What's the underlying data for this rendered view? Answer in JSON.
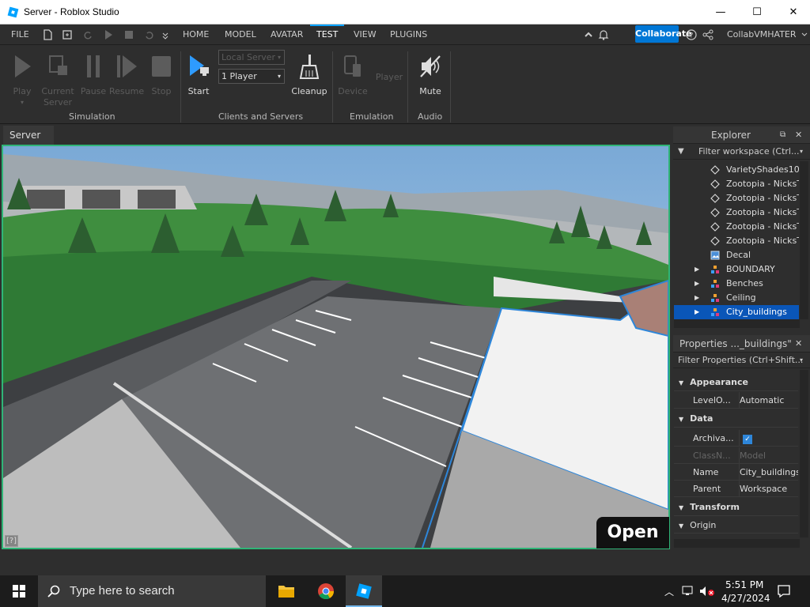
{
  "window": {
    "title": "Server - Roblox Studio",
    "minimize": "—",
    "maximize": "☐",
    "close": "✕"
  },
  "menubar": {
    "file": "FILE",
    "tabs": [
      {
        "label": "HOME"
      },
      {
        "label": "MODEL"
      },
      {
        "label": "AVATAR"
      },
      {
        "label": "TEST"
      },
      {
        "label": "VIEW"
      },
      {
        "label": "PLUGINS"
      }
    ],
    "active_tab": "TEST",
    "collaborate": "Collaborate",
    "username": "CollabVMHATER"
  },
  "ribbon": {
    "simulation": {
      "label": "Simulation",
      "play": "Play",
      "current_server_1": "Current",
      "current_server_2": "Server",
      "pause": "Pause",
      "resume": "Resume",
      "stop": "Stop"
    },
    "clients": {
      "label": "Clients and Servers",
      "start": "Start",
      "server_dd": "Local Server",
      "players_dd": "1 Player",
      "cleanup": "Cleanup"
    },
    "emulation": {
      "label": "Emulation",
      "device": "Device",
      "player": "Player"
    },
    "audio": {
      "label": "Audio",
      "mute": "Mute"
    }
  },
  "doc_tab": {
    "label": "Server",
    "close": "✕"
  },
  "viewport": {
    "help": "[?]",
    "open": "Open"
  },
  "explorer": {
    "title": "Explorer",
    "filter": "Filter workspace (Ctrl...",
    "items": [
      {
        "label": "VarietyShades10",
        "kind": "mesh"
      },
      {
        "label": "Zootopia - NicksTi",
        "kind": "mesh"
      },
      {
        "label": "Zootopia - NicksTi",
        "kind": "mesh"
      },
      {
        "label": "Zootopia - NicksTi",
        "kind": "mesh"
      },
      {
        "label": "Zootopia - NicksTi",
        "kind": "mesh"
      },
      {
        "label": "Zootopia - NicksTi",
        "kind": "mesh"
      },
      {
        "label": "Decal",
        "kind": "decal"
      },
      {
        "label": "BOUNDARY",
        "kind": "model"
      },
      {
        "label": "Benches",
        "kind": "model"
      },
      {
        "label": "Ceiling",
        "kind": "model"
      },
      {
        "label": "City_buildings",
        "kind": "model"
      }
    ]
  },
  "properties": {
    "title": "Properties ..._buildings\"",
    "filter": "Filter Properties (Ctrl+Shift...",
    "sections": {
      "appearance": "Appearance",
      "data": "Data",
      "transform": "Transform",
      "origin": "Origin"
    },
    "rows": {
      "level_k": "LevelO...",
      "level_v": "Automatic",
      "arch_k": "Archiva...",
      "class_k": "ClassN...",
      "class_v": "Model",
      "name_k": "Name",
      "name_v": "City_buildings",
      "parent_k": "Parent",
      "parent_v": "Workspace"
    }
  },
  "taskbar": {
    "search_placeholder": "Type here to search",
    "time": "5:51 PM",
    "date": "4/27/2024"
  },
  "colors": {
    "accent": "#00a2ff",
    "selection": "#0a56b8",
    "viewport_border": "#2fb577"
  }
}
